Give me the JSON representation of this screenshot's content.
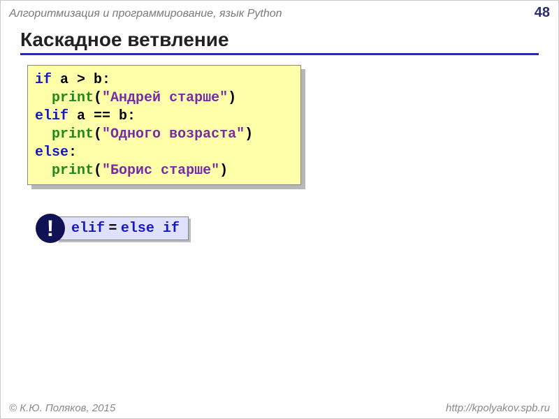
{
  "header": {
    "subject": "Алгоритмизация и программирование, язык Python",
    "page": "48"
  },
  "title": "Каскадное ветвление",
  "code": {
    "l1_kw": "if",
    "l1_cond": " a > b:",
    "l2_indent": "  ",
    "l2_fn": "print",
    "l2_op": "(",
    "l2_str": "\"Андрей старше\"",
    "l2_cp": ")",
    "l3_kw": "elif",
    "l3_cond": " a == b:",
    "l4_indent": "  ",
    "l4_fn": "print",
    "l4_op": "(",
    "l4_str": "\"Одного возраста\"",
    "l4_cp": ")",
    "l5_kw": "else",
    "l5_colon": ":",
    "l6_indent": "  ",
    "l6_fn": "print",
    "l6_op": "(",
    "l6_str": "\"Борис старше\"",
    "l6_cp": ")"
  },
  "note": {
    "bang": "!",
    "elif": "elif",
    "eq": " = ",
    "else_if": "else if"
  },
  "footer": {
    "author": "© К.Ю. Поляков, 2015",
    "url": "http://kpolyakov.spb.ru"
  }
}
